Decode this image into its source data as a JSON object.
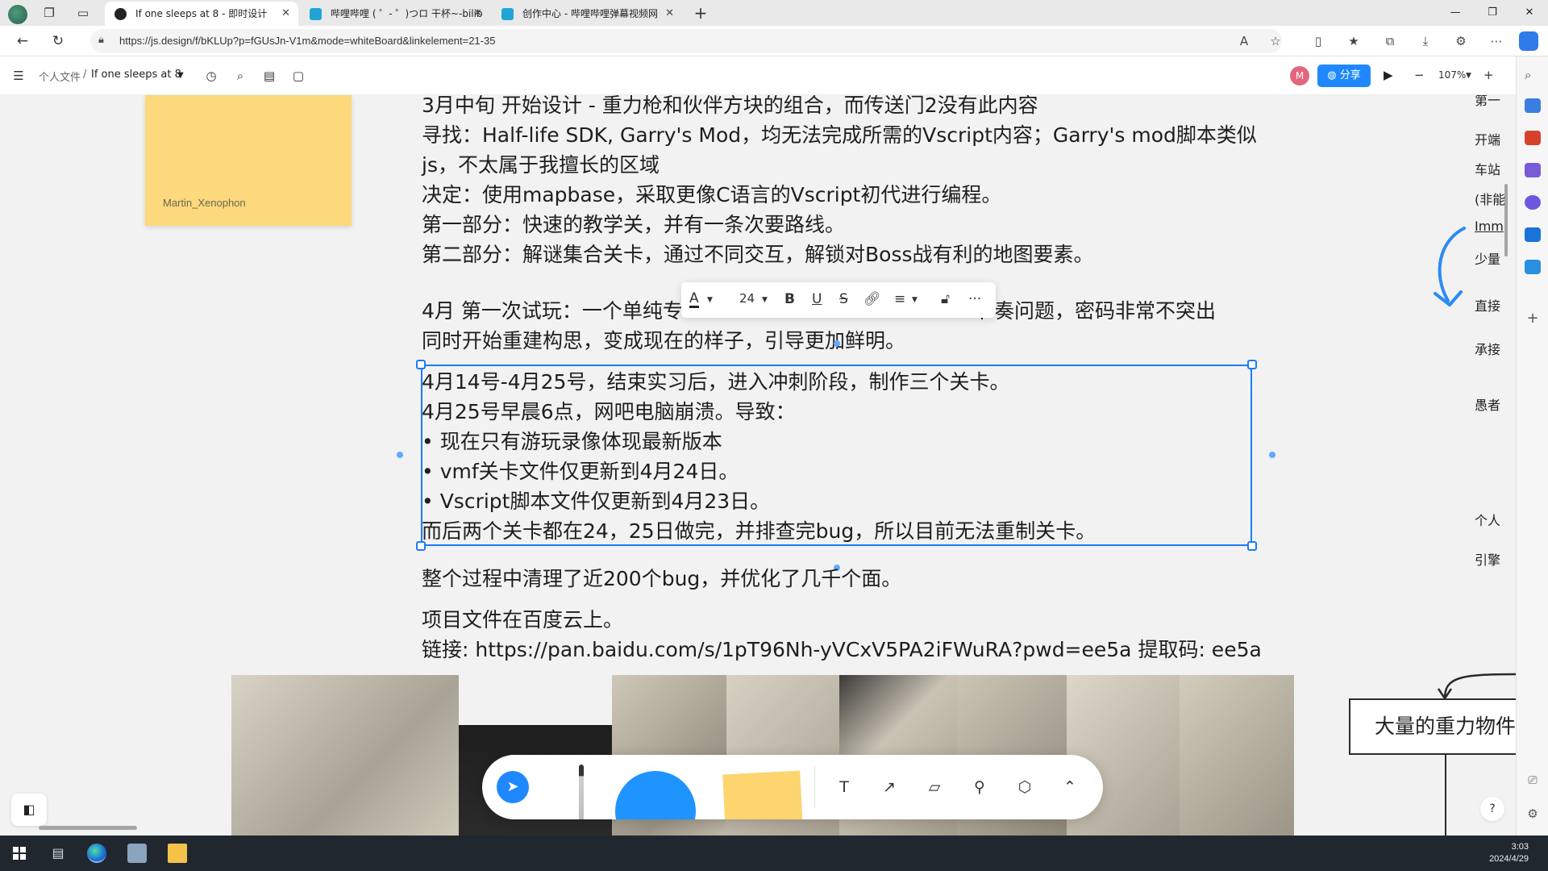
{
  "browser": {
    "tabs": [
      {
        "label": "If one sleeps at 8 - 即时设计",
        "close": "✕"
      },
      {
        "label": "哔哩哔哩 ( ゜- ゜)つロ 干杯~-bilib",
        "close": "✕"
      },
      {
        "label": "创作中心 - 哔哩哔哩弹幕视频网",
        "close": "✕"
      }
    ],
    "new_tab": "+",
    "url": "https://js.design/f/bKLUp?p=fGUsJn-V1m&mode=whiteBoard&linkelement=21-35"
  },
  "app": {
    "breadcrumb_root": "个人文件",
    "breadcrumb_sep": "/",
    "doc_title": "If one sleeps at 8",
    "avatar_letter": "M",
    "share_label": "分享",
    "zoom_level": "107%",
    "zoom_minus": "−",
    "zoom_plus": "+"
  },
  "canvas": {
    "sticky_author": "Martin_Xenophon",
    "doc_lines": [
      "3月中旬 开始设计 - 重力枪和伙伴方块的组合，而传送门2没有此内容",
      "寻找：Half-life SDK, Garry's Mod，均无法完成所需的Vscript内容；Garry's mod脚本类似",
      "js，不太属于我擅长的区域",
      "决定：使用mapbase，采取更像C语言的Vscript初代进行编程。",
      "第一部分：快速的教学关，并有一条次要路线。",
      "第二部分：解谜集合关卡，通过不同交互，解锁对Boss战有利的地图要素。",
      "4月 第一次试玩：一个单纯专",
      "节奏问题，密码非常不突出",
      "同时开始重建构思，变成现在的样子，引导更加鲜明。"
    ],
    "selected_lines": [
      "4月14号-4月25号，结束实习后，进入冲刺阶段，制作三个关卡。",
      "4月25号早晨6点，网吧电脑崩溃。导致：",
      "• 现在只有游玩录像体现最新版本",
      "• vmf关卡文件仅更新到4月24日。",
      "• Vscript脚本文件仅更新到4月23日。",
      "而后两个关卡都在24，25日做完，并排查完bug，所以目前无法重制关卡。"
    ],
    "after_lines": [
      "整个过程中清理了近200个bug，并优化了几千个面。",
      "项目文件在百度云上。",
      "链接: https://pan.baidu.com/s/1pT96Nh-yVCxV5PA2iFWuRA?pwd=ee5a 提取码: ee5a"
    ],
    "right_column": [
      "第一",
      "开端",
      "车站",
      "(非能",
      "Imm",
      "少量",
      "直接",
      "承接",
      "愚者",
      "个人",
      "引擎"
    ],
    "flow_box_label": "大量的重力物件",
    "format_toolbar": {
      "font_size": "24",
      "bold": "B",
      "underline": "U",
      "strike": "S",
      "more": "···"
    },
    "help": "?"
  },
  "taskbar": {
    "time": "3:03",
    "date": "2024/4/29"
  },
  "colors": {
    "accent": "#1f88ff",
    "selection": "#1d7bf5",
    "sticky": "#fbd97c",
    "avatar": "#e5657e"
  }
}
